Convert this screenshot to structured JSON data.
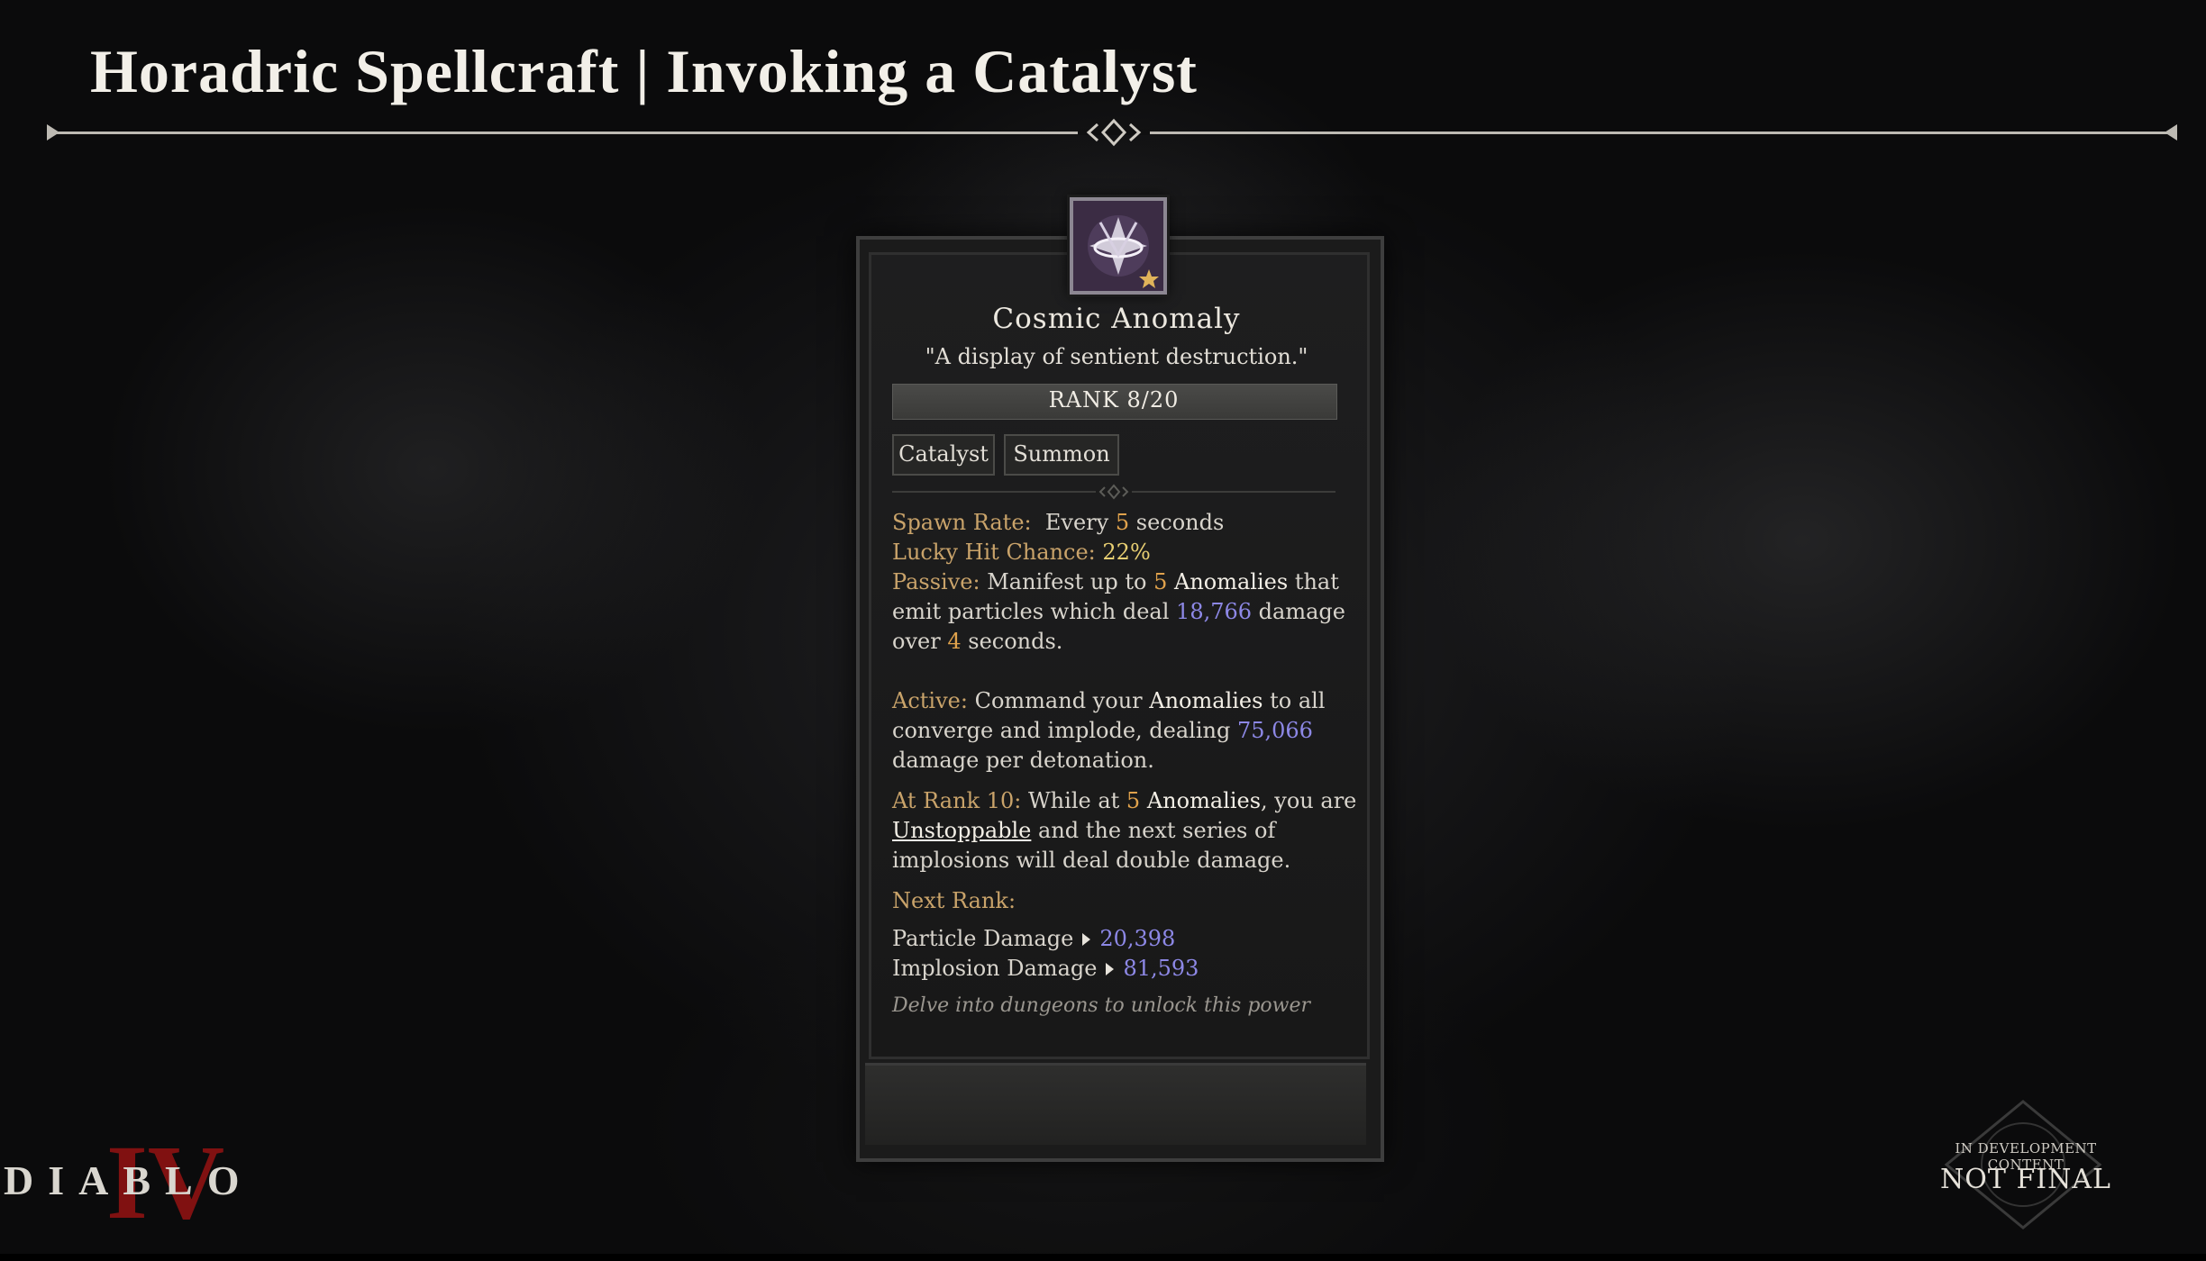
{
  "header": {
    "title": "Horadric Spellcraft | Invoking a Catalyst"
  },
  "power": {
    "icon": "cosmic-anomaly-icon",
    "name": "Cosmic Anomaly",
    "flavor": "\"A display of sentient destruction.\"",
    "rank": "RANK 8/20",
    "tags": [
      "Catalyst",
      "Summon"
    ]
  },
  "stats": {
    "spawn_rate_label": "Spawn Rate:",
    "spawn_rate_pre": "Every",
    "spawn_rate_value": "5",
    "spawn_rate_post": "seconds",
    "lucky_label": "Lucky Hit Chance:",
    "lucky_value": "22%",
    "passive_label": "Passive:",
    "passive_1": "Manifest up to",
    "passive_count": "5",
    "passive_keyword": "Anomalies",
    "passive_2": "that",
    "passive_3": "emit particles which deal",
    "passive_damage": "18,766",
    "passive_4": "damage",
    "passive_5": "over",
    "passive_duration": "4",
    "passive_6": "seconds.",
    "active_label": "Active:",
    "active_1": "Command your",
    "active_keyword": "Anomalies",
    "active_2": "to all",
    "active_3": "converge and implode, dealing",
    "active_damage": "75,066",
    "active_4": "damage per detonation.",
    "rank10_label": "At Rank 10:",
    "rank10_1": "While at",
    "rank10_count": "5",
    "rank10_keyword": "Anomalies",
    "rank10_2": ", you are",
    "rank10_link": "Unstoppable",
    "rank10_3": "and the next series of",
    "rank10_4": "implosions will deal double damage.",
    "next_rank_label": "Next Rank:",
    "particle_label": "Particle Damage",
    "particle_value": "20,398",
    "implosion_label": "Implosion Damage",
    "implosion_value": "81,593",
    "unlock_hint": "Delve into dungeons to unlock this power"
  },
  "branding": {
    "logo_text": "DIABLO",
    "logo_numeral": "IV",
    "watermark_small": "IN DEVELOPMENT CONTENT",
    "watermark_big": "NOT FINAL"
  },
  "colors": {
    "label_gold": "#c9a36a",
    "number_orange": "#e0a24c",
    "damage_purple": "#8d88e6",
    "logo_red": "#8a1212"
  }
}
